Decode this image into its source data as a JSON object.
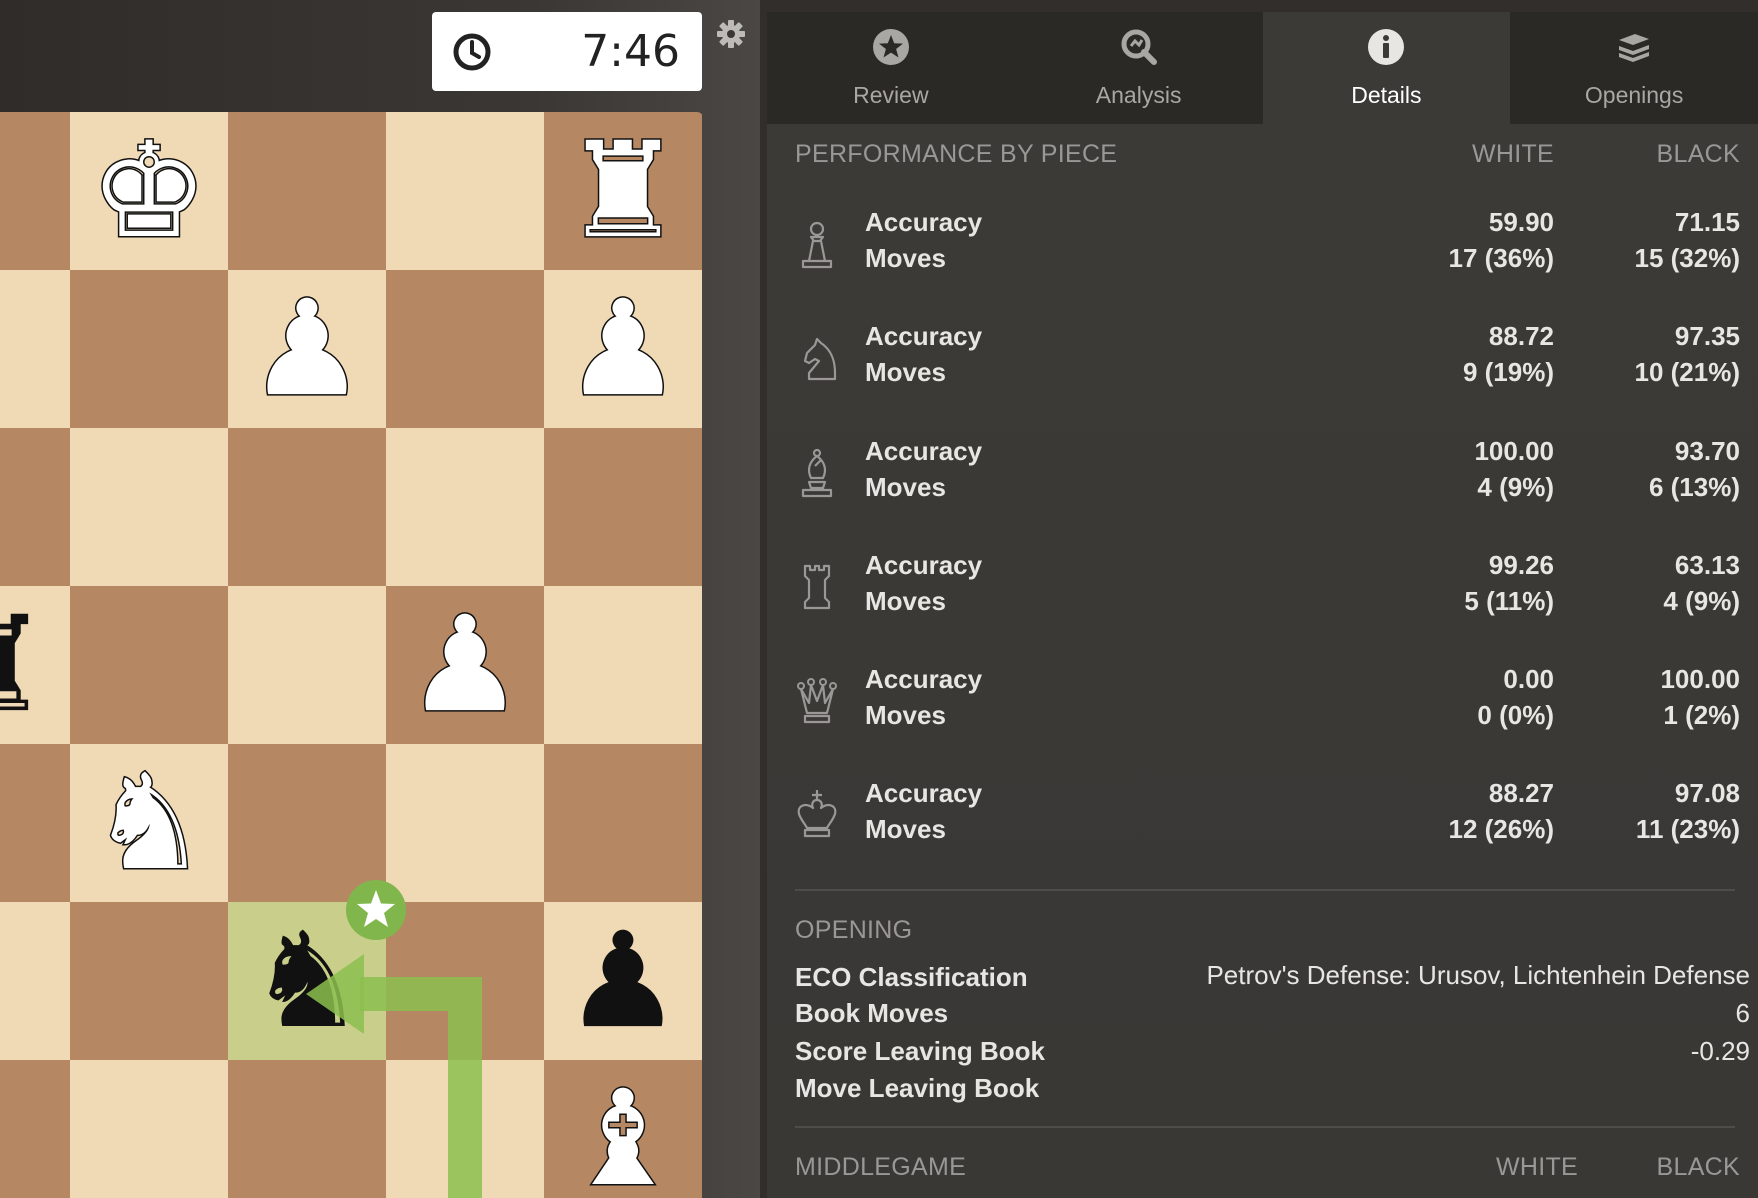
{
  "clock": {
    "time": "7:46"
  },
  "tabs": [
    {
      "label": "Review",
      "icon": "star-circle-icon"
    },
    {
      "label": "Analysis",
      "icon": "magnifier-icon"
    },
    {
      "label": "Details",
      "icon": "info-circle-icon",
      "active": true
    },
    {
      "label": "Openings",
      "icon": "book-stack-icon"
    }
  ],
  "performance": {
    "header": "PERFORMANCE BY PIECE",
    "white_label": "WHITE",
    "black_label": "BLACK",
    "accuracy_label": "Accuracy",
    "moves_label": "Moves",
    "rows": [
      {
        "piece": "pawn-icon",
        "white_acc": "59.90",
        "black_acc": "71.15",
        "white_moves": "17 (36%)",
        "black_moves": "15 (32%)"
      },
      {
        "piece": "knight-icon",
        "white_acc": "88.72",
        "black_acc": "97.35",
        "white_moves": "9 (19%)",
        "black_moves": "10 (21%)"
      },
      {
        "piece": "bishop-icon",
        "white_acc": "100.00",
        "black_acc": "93.70",
        "white_moves": "4 (9%)",
        "black_moves": "6 (13%)"
      },
      {
        "piece": "rook-icon",
        "white_acc": "99.26",
        "black_acc": "63.13",
        "white_moves": "5 (11%)",
        "black_moves": "4 (9%)"
      },
      {
        "piece": "queen-icon",
        "white_acc": "0.00",
        "black_acc": "100.00",
        "white_moves": "0 (0%)",
        "black_moves": "1 (2%)"
      },
      {
        "piece": "king-icon",
        "white_acc": "88.27",
        "black_acc": "97.08",
        "white_moves": "12 (26%)",
        "black_moves": "11 (23%)"
      }
    ]
  },
  "opening": {
    "header": "OPENING",
    "eco_label": "ECO Classification",
    "eco_value": "Petrov's Defense: Urusov, Lichtenhein Defense",
    "book_moves_label": "Book Moves",
    "book_moves_value": "6",
    "score_label": "Score Leaving Book",
    "score_value": "-0.29",
    "move_label": "Move Leaving Book"
  },
  "middlegame": {
    "header": "MIDDLEGAME",
    "white_label": "WHITE",
    "black_label": "BLACK"
  },
  "board_pieces": {
    "top_row": [
      "white-king",
      "white-rook"
    ],
    "glyphs": {
      "K": "♚",
      "Q": "♛",
      "R": "♜",
      "B": "♝",
      "N": "♞",
      "P": "♟"
    }
  },
  "colors": {
    "light_square": "#f0d9b5",
    "dark_square": "#b58863",
    "highlight": "#c9cf8a",
    "arrow": "#8cc04f",
    "badge": "#81b64c"
  }
}
